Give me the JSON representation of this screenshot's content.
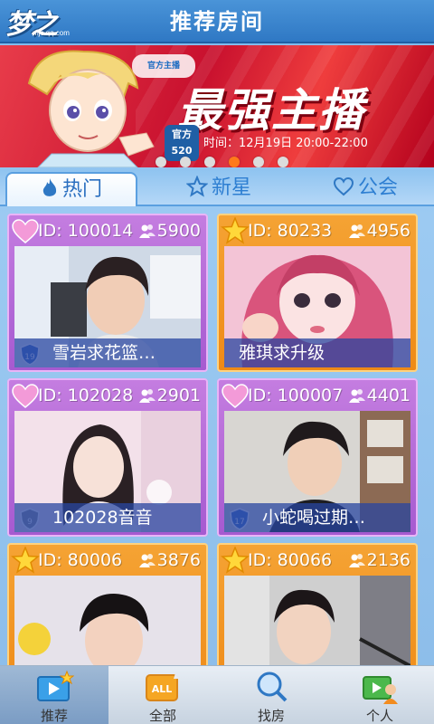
{
  "header": {
    "title": "推荐房间",
    "logo_sub": "mjc.qq.com"
  },
  "banner": {
    "brand": "官方主播",
    "headline": "最强主播",
    "official_line1": "官方",
    "official_line2": "520",
    "time": "时间：12月19日 20:00-22:00",
    "dots": 6,
    "active_dot": 3
  },
  "tabs": [
    {
      "label": "热门",
      "icon": "flame-icon",
      "active": true
    },
    {
      "label": "新星",
      "icon": "star-icon",
      "active": false
    },
    {
      "label": "公会",
      "icon": "heart-icon",
      "active": false
    }
  ],
  "rooms": [
    {
      "id_label": "ID: 100014",
      "count": "5900",
      "caption": "雪岩求花篮…",
      "level": "19",
      "theme": "purple",
      "badge": "heart"
    },
    {
      "id_label": "ID: 80233",
      "count": "4956",
      "caption": "雅琪求升级",
      "level": "",
      "theme": "orange",
      "badge": "star"
    },
    {
      "id_label": "ID: 102028",
      "count": "2901",
      "caption": "102028音音",
      "level": "9",
      "theme": "purple",
      "badge": "heart"
    },
    {
      "id_label": "ID: 100007",
      "count": "4401",
      "caption": "小蛇喝过期…",
      "level": "17",
      "theme": "purple",
      "badge": "heart"
    },
    {
      "id_label": "ID: 80006",
      "count": "3876",
      "caption": "",
      "level": "",
      "theme": "orange",
      "badge": "star"
    },
    {
      "id_label": "ID: 80066",
      "count": "2136",
      "caption": "",
      "level": "",
      "theme": "orange",
      "badge": "star"
    }
  ],
  "bottom_nav": [
    {
      "label": "推荐",
      "icon": "recommend-icon",
      "active": true
    },
    {
      "label": "全部",
      "icon": "all-icon",
      "active": false
    },
    {
      "label": "找房",
      "icon": "search-icon",
      "active": false
    },
    {
      "label": "个人",
      "icon": "person-icon",
      "active": false
    }
  ],
  "colors": {
    "header": "#2f78c4",
    "banner": "#c8102e",
    "card_purple": "#a65ad0",
    "card_orange": "#ee8a17",
    "active_dot": "#ff7a1a"
  }
}
